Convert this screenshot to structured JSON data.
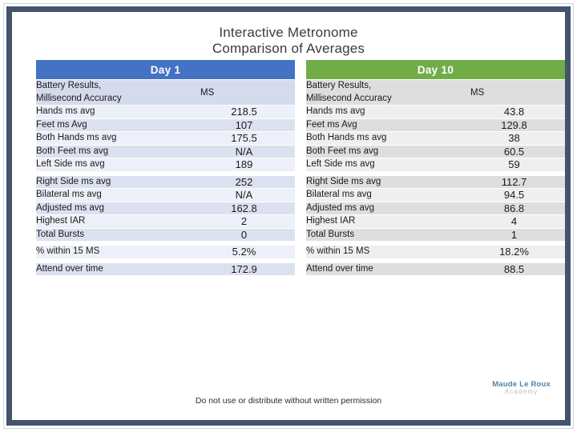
{
  "title": {
    "line1": "Interactive Metronome",
    "line2": "Comparison of Averages"
  },
  "tables": [
    {
      "day_header": "Day 1",
      "accent": "#4472C4",
      "sub_header": {
        "label": "Battery Results, Millisecond Accuracy",
        "label_line1": "Battery Results,",
        "label_line2": "Millisecond Accuracy",
        "value": "MS"
      },
      "rows": [
        {
          "label": "Hands ms avg",
          "value": "218.5"
        },
        {
          "label": "Feet ms Avg",
          "value": "107"
        },
        {
          "label": "Both Hands ms avg",
          "value": "175.5"
        },
        {
          "label": "Both Feet ms avg",
          "value": "N/A"
        },
        {
          "label": "Left Side ms avg",
          "value": "189"
        },
        {
          "label": "Right Side ms avg",
          "value": "252"
        },
        {
          "label": "Bilateral ms avg",
          "value": "N/A"
        },
        {
          "label": "Adjusted ms avg",
          "value": "162.8"
        },
        {
          "label": "Highest IAR",
          "value": "2"
        },
        {
          "label": "Total Bursts",
          "value": "0"
        },
        {
          "label": "% within 15 MS",
          "value": "5.2%"
        },
        {
          "label": "Attend over time",
          "value": "172.9"
        }
      ]
    },
    {
      "day_header": "Day 10",
      "accent": "#70AD47",
      "sub_header": {
        "label": "Battery Results, Millisecond Accuracy",
        "label_line1": "Battery Results,",
        "label_line2": "Millisecond Accuracy",
        "value": "MS"
      },
      "rows": [
        {
          "label": "Hands ms avg",
          "value": "43.8"
        },
        {
          "label": "Feet ms Avg",
          "value": "129.8"
        },
        {
          "label": "Both Hands ms avg",
          "value": "38"
        },
        {
          "label": "Both Feet ms avg",
          "value": "60.5"
        },
        {
          "label": "Left Side ms avg",
          "value": "59"
        },
        {
          "label": "Right Side ms avg",
          "value": "112.7"
        },
        {
          "label": "Bilateral ms avg",
          "value": "94.5"
        },
        {
          "label": "Adjusted ms avg",
          "value": "86.8"
        },
        {
          "label": "Highest IAR",
          "value": "4"
        },
        {
          "label": "Total Bursts",
          "value": "1"
        },
        {
          "label": "% within 15 MS",
          "value": "18.2%"
        },
        {
          "label": "Attend over time",
          "value": "88.5"
        }
      ]
    }
  ],
  "footer": {
    "note": "Do not use or distribute without written permission"
  },
  "logo": {
    "name": "Maude Le Roux",
    "subtitle": "Academy"
  }
}
